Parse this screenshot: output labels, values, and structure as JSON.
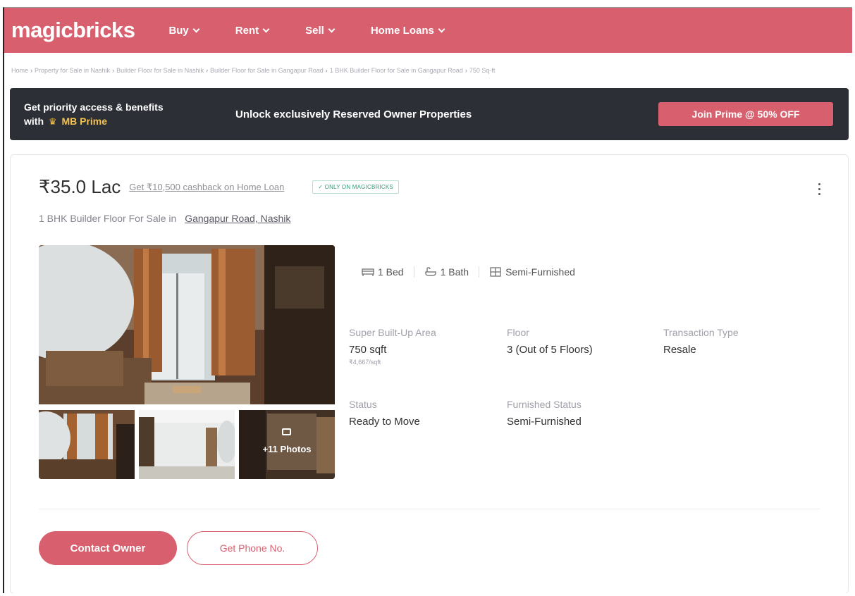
{
  "header": {
    "logo": "magicbricks",
    "nav": [
      "Buy",
      "Rent",
      "Sell",
      "Home Loans"
    ]
  },
  "breadcrumb": [
    "Home",
    "Property for Sale in Nashik",
    "Builder Floor for Sale in Nashik",
    "Builder Floor for Sale in Gangapur Road",
    "1 BHK Builder Floor for Sale in Gangapur Road",
    "750 Sq-ft"
  ],
  "prime_banner": {
    "line1": "Get priority access & benefits",
    "line2_prefix": "with",
    "brand": "MB Prime",
    "message": "Unlock exclusively Reserved Owner Properties",
    "button": "Join Prime @ 50% OFF"
  },
  "listing": {
    "price": "₹35.0 Lac",
    "cashback": "Get ₹10,500 cashback on Home Loan",
    "badge": "✓ ONLY ON MAGICBRICKS",
    "subtitle_prefix": "1 BHK Builder Floor For Sale in",
    "location": "Gangapur Road, Nashik",
    "more_photos": "+11 Photos",
    "chips": [
      "1 Bed",
      "1 Bath",
      "Semi-Furnished"
    ],
    "details": {
      "area_label": "Super Built-Up Area",
      "area_value": "750 sqft",
      "area_sub": "₹4,667/sqft",
      "floor_label": "Floor",
      "floor_value": "3 (Out of 5 Floors)",
      "transaction_label": "Transaction Type",
      "transaction_value": "Resale",
      "status_label": "Status",
      "status_value": "Ready to Move",
      "furnished_label": "Furnished Status",
      "furnished_value": "Semi-Furnished"
    },
    "contact_button": "Contact Owner",
    "phone_button": "Get Phone No."
  },
  "colors": {
    "brand": "#d8606e",
    "banner_bg": "#2c2f36",
    "prime_gold": "#f2c14e",
    "badge_green": "#2e9c73"
  }
}
